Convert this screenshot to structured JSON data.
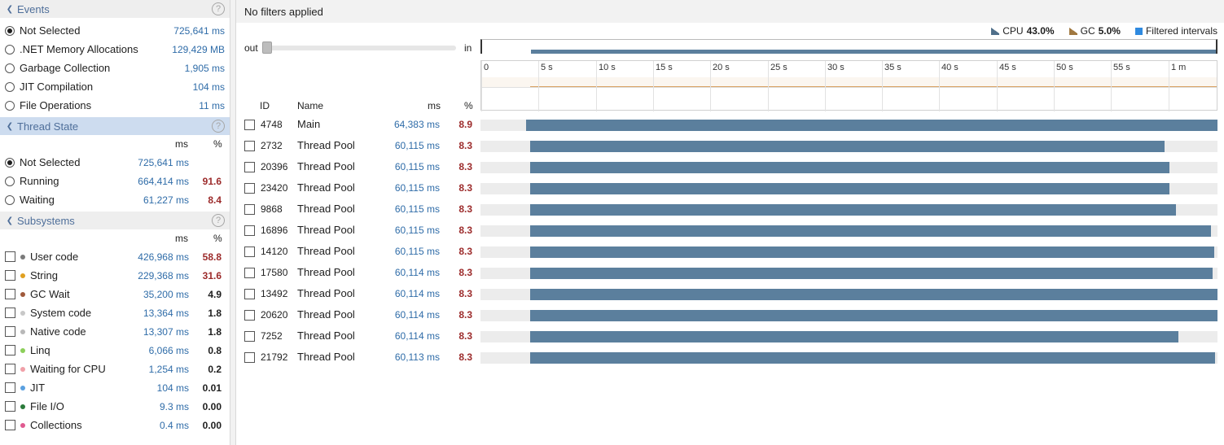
{
  "events": {
    "title": "Events",
    "items": [
      {
        "label": "Not Selected",
        "value": "725,641 ms",
        "selected": true
      },
      {
        "label": ".NET Memory Allocations",
        "value": "129,429 MB",
        "selected": false
      },
      {
        "label": "Garbage Collection",
        "value": "1,905 ms",
        "selected": false
      },
      {
        "label": "JIT Compilation",
        "value": "104 ms",
        "selected": false
      },
      {
        "label": "File Operations",
        "value": "11 ms",
        "selected": false
      }
    ]
  },
  "thread_state": {
    "title": "Thread State",
    "col_ms": "ms",
    "col_pct": "%",
    "items": [
      {
        "label": "Not Selected",
        "value": "725,641 ms",
        "pct": "",
        "selected": true
      },
      {
        "label": "Running",
        "value": "664,414 ms",
        "pct": "91.6",
        "selected": false
      },
      {
        "label": "Waiting",
        "value": "61,227 ms",
        "pct": "8.4",
        "selected": false
      }
    ]
  },
  "subsystems": {
    "title": "Subsystems",
    "col_ms": "ms",
    "col_pct": "%",
    "items": [
      {
        "label": "User code",
        "value": "426,968 ms",
        "pct": "58.8",
        "color": "#7a7a7a",
        "pct_color": "red"
      },
      {
        "label": "String",
        "value": "229,368 ms",
        "pct": "31.6",
        "color": "#e0a020",
        "pct_color": "red"
      },
      {
        "label": "GC Wait",
        "value": "35,200 ms",
        "pct": "4.9",
        "color": "#a05a3c",
        "pct_color": "dark"
      },
      {
        "label": "System code",
        "value": "13,364 ms",
        "pct": "1.8",
        "color": "#c8c8c8",
        "pct_color": "dark"
      },
      {
        "label": "Native code",
        "value": "13,307 ms",
        "pct": "1.8",
        "color": "#b8b8b8",
        "pct_color": "dark"
      },
      {
        "label": "Linq",
        "value": "6,066 ms",
        "pct": "0.8",
        "color": "#8ccf5a",
        "pct_color": "dark"
      },
      {
        "label": "Waiting for CPU",
        "value": "1,254 ms",
        "pct": "0.2",
        "color": "#f0a0a8",
        "pct_color": "dark"
      },
      {
        "label": "JIT",
        "value": "104 ms",
        "pct": "0.01",
        "color": "#5aa0e0",
        "pct_color": "dark"
      },
      {
        "label": "File I/O",
        "value": "9.3 ms",
        "pct": "0.00",
        "color": "#2a7a3a",
        "pct_color": "dark"
      },
      {
        "label": "Collections",
        "value": "0.4 ms",
        "pct": "0.00",
        "color": "#e05a90",
        "pct_color": "dark"
      }
    ]
  },
  "help_glyph": "?",
  "filter_text": "No filters applied",
  "legend": [
    {
      "name": "CPU",
      "value": "43.0%",
      "color": "#4f6f8a",
      "icon": "cpu-chart-icon"
    },
    {
      "name": "GC",
      "value": "5.0%",
      "color": "#a07840",
      "icon": "gc-chart-icon"
    },
    {
      "name": "Filtered intervals",
      "value": "",
      "color": "#2f8ae0",
      "icon": "filtered-square-icon"
    }
  ],
  "zoom": {
    "out_label": "out",
    "in_label": "in",
    "level": 0
  },
  "ruler_ticks": [
    "0",
    "5 s",
    "10 s",
    "15 s",
    "20 s",
    "25 s",
    "30 s",
    "35 s",
    "40 s",
    "45 s",
    "50 s",
    "55 s",
    "1 m"
  ],
  "thread_table": {
    "col_id": "ID",
    "col_name": "Name",
    "col_ms": "ms",
    "col_pct": "%",
    "total_seconds": 64.3,
    "rows": [
      {
        "id": "4748",
        "name": "Main",
        "ms": "64,383 ms",
        "pct": "8.9",
        "start_s": 4.0,
        "end_s": 64.3,
        "pre_gray": true
      },
      {
        "id": "2732",
        "name": "Thread Pool",
        "ms": "60,115 ms",
        "pct": "8.3",
        "start_s": 4.3,
        "end_s": 59.7
      },
      {
        "id": "20396",
        "name": "Thread Pool",
        "ms": "60,115 ms",
        "pct": "8.3",
        "start_s": 4.3,
        "end_s": 60.1
      },
      {
        "id": "23420",
        "name": "Thread Pool",
        "ms": "60,115 ms",
        "pct": "8.3",
        "start_s": 4.3,
        "end_s": 60.1
      },
      {
        "id": "9868",
        "name": "Thread Pool",
        "ms": "60,115 ms",
        "pct": "8.3",
        "start_s": 4.3,
        "end_s": 60.7
      },
      {
        "id": "16896",
        "name": "Thread Pool",
        "ms": "60,115 ms",
        "pct": "8.3",
        "start_s": 4.3,
        "end_s": 63.7
      },
      {
        "id": "14120",
        "name": "Thread Pool",
        "ms": "60,115 ms",
        "pct": "8.3",
        "start_s": 4.3,
        "end_s": 64.0
      },
      {
        "id": "17580",
        "name": "Thread Pool",
        "ms": "60,114 ms",
        "pct": "8.3",
        "start_s": 4.3,
        "end_s": 63.9
      },
      {
        "id": "13492",
        "name": "Thread Pool",
        "ms": "60,114 ms",
        "pct": "8.3",
        "start_s": 4.3,
        "end_s": 64.3
      },
      {
        "id": "20620",
        "name": "Thread Pool",
        "ms": "60,114 ms",
        "pct": "8.3",
        "start_s": 4.3,
        "end_s": 64.3
      },
      {
        "id": "7252",
        "name": "Thread Pool",
        "ms": "60,114 ms",
        "pct": "8.3",
        "start_s": 4.3,
        "end_s": 60.9
      },
      {
        "id": "21792",
        "name": "Thread Pool",
        "ms": "60,113 ms",
        "pct": "8.3",
        "start_s": 4.3,
        "end_s": 64.1
      }
    ]
  }
}
